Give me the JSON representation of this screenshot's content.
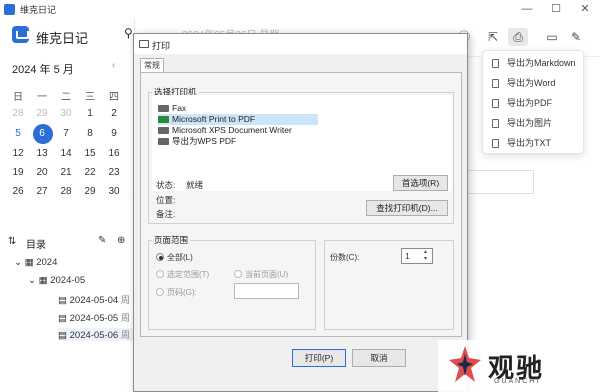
{
  "window": {
    "title": "维克日记",
    "minimize": "—",
    "maximize": "☐",
    "close": "✕"
  },
  "sidebar": {
    "app_name": "维克日记",
    "month": "2024 年 5 月",
    "weekdays": [
      "日",
      "一",
      "二",
      "三",
      "四",
      "五"
    ],
    "calendar": [
      [
        "28",
        "29",
        "30",
        "1",
        "2",
        "3"
      ],
      [
        "5",
        "6",
        "7",
        "8",
        "9",
        "10"
      ],
      [
        "12",
        "13",
        "14",
        "15",
        "16",
        "17"
      ],
      [
        "19",
        "20",
        "21",
        "22",
        "23",
        "24"
      ],
      [
        "26",
        "27",
        "28",
        "29",
        "30",
        "31"
      ]
    ],
    "selected_day": "6",
    "dir_label": "目录",
    "tree": {
      "year": "2024",
      "month": "2024-05",
      "files": [
        "2024-05-04",
        "2024-05-05",
        "2024-05-06"
      ],
      "file_tag": "周"
    }
  },
  "main": {
    "date_header": "2024年05月06日 星期"
  },
  "export_menu": {
    "items": [
      "导出为Markdown",
      "导出为Word",
      "导出为PDF",
      "导出为图片",
      "导出为TXT"
    ]
  },
  "dialog": {
    "title": "打印",
    "tab": "常规",
    "select_printer_label": "选择打印机",
    "printers": [
      "Fax",
      "Microsoft Print to PDF",
      "Microsoft XPS Document Writer",
      "导出为WPS PDF"
    ],
    "selected_printer": "Microsoft Print to PDF",
    "status_label": "状态:",
    "status_value": "就绪",
    "location_label": "位置:",
    "comment_label": "备注:",
    "preferences_button": "首选项(R)",
    "find_printer_button": "查找打印机(D)...",
    "page_range_label": "页面范围",
    "range_all": "全部(L)",
    "range_selection": "选定范围(T)",
    "range_current": "当前页面(U)",
    "range_pages": "页码(G):",
    "copies_label": "份数(C):",
    "copies_value": "1",
    "print_button": "打印(P)",
    "cancel_button": "取消"
  },
  "watermark": {
    "text": "观驰",
    "sub": "GUANCHI"
  },
  "colors": {
    "accent": "#2b6fd6",
    "selected_row": "#cce4fa"
  }
}
